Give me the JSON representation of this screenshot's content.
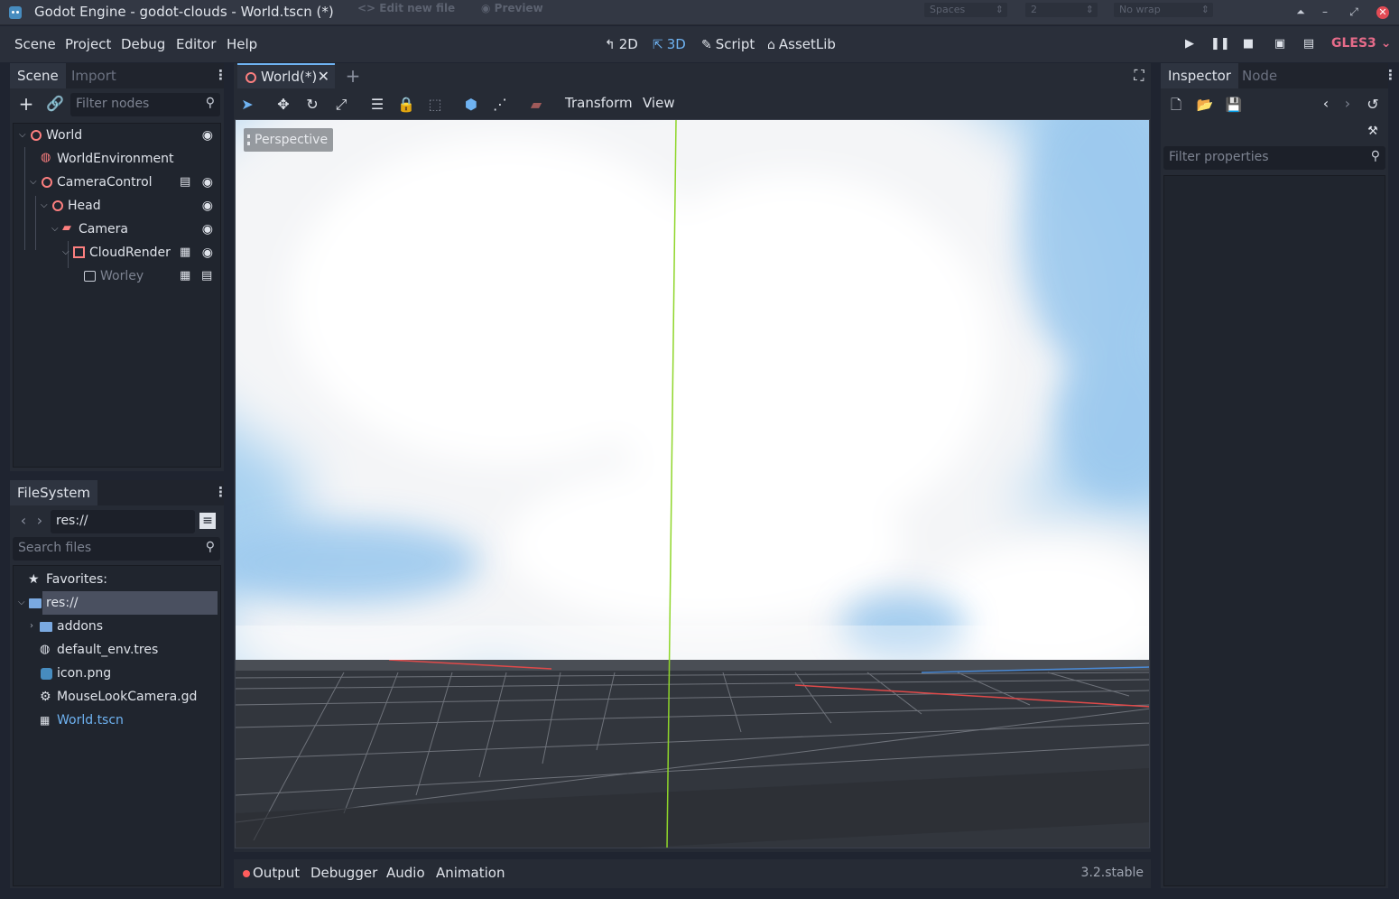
{
  "window": {
    "title": "Godot Engine - godot-clouds - World.tscn (*)",
    "ghost_edit": "<> Edit new file",
    "ghost_preview": "◉ Preview",
    "ghost_spaces": "Spaces",
    "ghost_two": "2",
    "ghost_nowrap": "No wrap"
  },
  "menu": {
    "items": [
      "Scene",
      "Project",
      "Debug",
      "Editor",
      "Help"
    ]
  },
  "workspaces": {
    "two_d": "2D",
    "three_d": "3D",
    "script": "Script",
    "assetlib": "AssetLib",
    "active": "3D"
  },
  "renderer": "GLES3",
  "scene_dock": {
    "tabs": [
      "Scene",
      "Import"
    ],
    "filter_placeholder": "Filter nodes",
    "nodes": [
      "World",
      "WorldEnvironment",
      "CameraControl",
      "Head",
      "Camera",
      "CloudRender",
      "Worley"
    ]
  },
  "filesystem": {
    "tab": "FileSystem",
    "path": "res://",
    "search_placeholder": "Search files",
    "favorites": "Favorites:",
    "items": [
      "res://",
      "addons",
      "default_env.tres",
      "icon.png",
      "MouseLookCamera.gd",
      "World.tscn"
    ]
  },
  "editor": {
    "scene_tab": "World(*)",
    "menus": {
      "transform": "Transform",
      "view": "View"
    },
    "perspective_label": "Perspective"
  },
  "bottom": {
    "tabs": [
      "Output",
      "Debugger",
      "Audio",
      "Animation"
    ],
    "version": "3.2.stable"
  },
  "inspector": {
    "tabs": [
      "Inspector",
      "Node"
    ],
    "filter_placeholder": "Filter properties"
  },
  "colors": {
    "accent": "#6fb3f2",
    "node_red": "#fc7f7f",
    "renderer": "#e56b89",
    "sky": "#a8d1f0",
    "y_axis": "#8fd62a"
  }
}
